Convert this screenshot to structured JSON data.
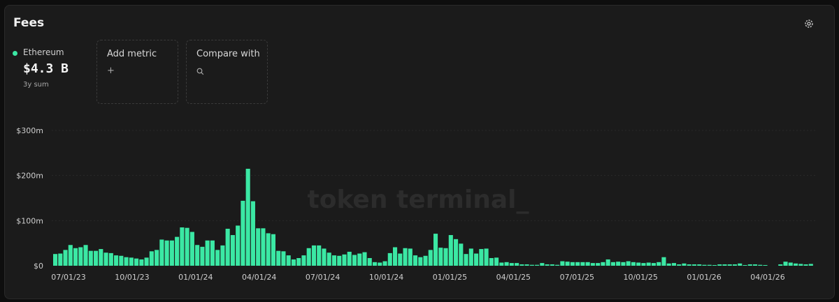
{
  "header": {
    "title": "Fees",
    "settings_icon": "gear-icon"
  },
  "metric": {
    "name": "Ethereum",
    "value": "$4.3 B",
    "sub": "3y sum",
    "color": "#3be8a4"
  },
  "add_metric": {
    "label": "Add metric",
    "icon": "plus-icon",
    "glyph": "+"
  },
  "compare": {
    "label": "Compare with",
    "icon": "search-icon"
  },
  "watermark": "token terminal_",
  "chart_data": {
    "type": "bar",
    "color": "#3be8a4",
    "series": [
      {
        "values": [
          26,
          27,
          35,
          46,
          39,
          41,
          46,
          33,
          33,
          37,
          29,
          28,
          23,
          22,
          19,
          18,
          16,
          14,
          18,
          32,
          35,
          58,
          56,
          56,
          64,
          85,
          84,
          75,
          46,
          42,
          56,
          56,
          35,
          45,
          82,
          68,
          89,
          144,
          215,
          143,
          83,
          83,
          72,
          70,
          33,
          32,
          23,
          14,
          17,
          23,
          39,
          45,
          45,
          38,
          29,
          23,
          22,
          25,
          31,
          24,
          27,
          30,
          17,
          8,
          7,
          10,
          28,
          41,
          27,
          39,
          38,
          23,
          19,
          22,
          35,
          71,
          40,
          39,
          68,
          59,
          49,
          26,
          38,
          27,
          37,
          38,
          17,
          18,
          7,
          8,
          6,
          6,
          3,
          3,
          2,
          2,
          6,
          3,
          3,
          2,
          10,
          9,
          8,
          8,
          8,
          8,
          6,
          6,
          8,
          14,
          8,
          9,
          8,
          10,
          8,
          7,
          6,
          7,
          6,
          8,
          19,
          5,
          6,
          3,
          5,
          3,
          3,
          3,
          2,
          2,
          1,
          3,
          3,
          3,
          3,
          5,
          1,
          3,
          3,
          2,
          1,
          0,
          0,
          3,
          9,
          7,
          5,
          4,
          3,
          4
        ]
      }
    ],
    "x_tick_labels": [
      "07/01/23",
      "10/01/23",
      "01/01/24",
      "04/01/24",
      "07/01/24",
      "10/01/24",
      "01/01/25",
      "04/01/25",
      "07/01/25",
      "10/01/25",
      "01/01/26",
      "04/01/26"
    ],
    "y_ticks": [
      0,
      100,
      200,
      300
    ],
    "y_tick_labels": [
      "$0",
      "$100m",
      "$200m",
      "$300m"
    ],
    "ylim": [
      0,
      300
    ],
    "grid": true,
    "legend": "top-left"
  }
}
